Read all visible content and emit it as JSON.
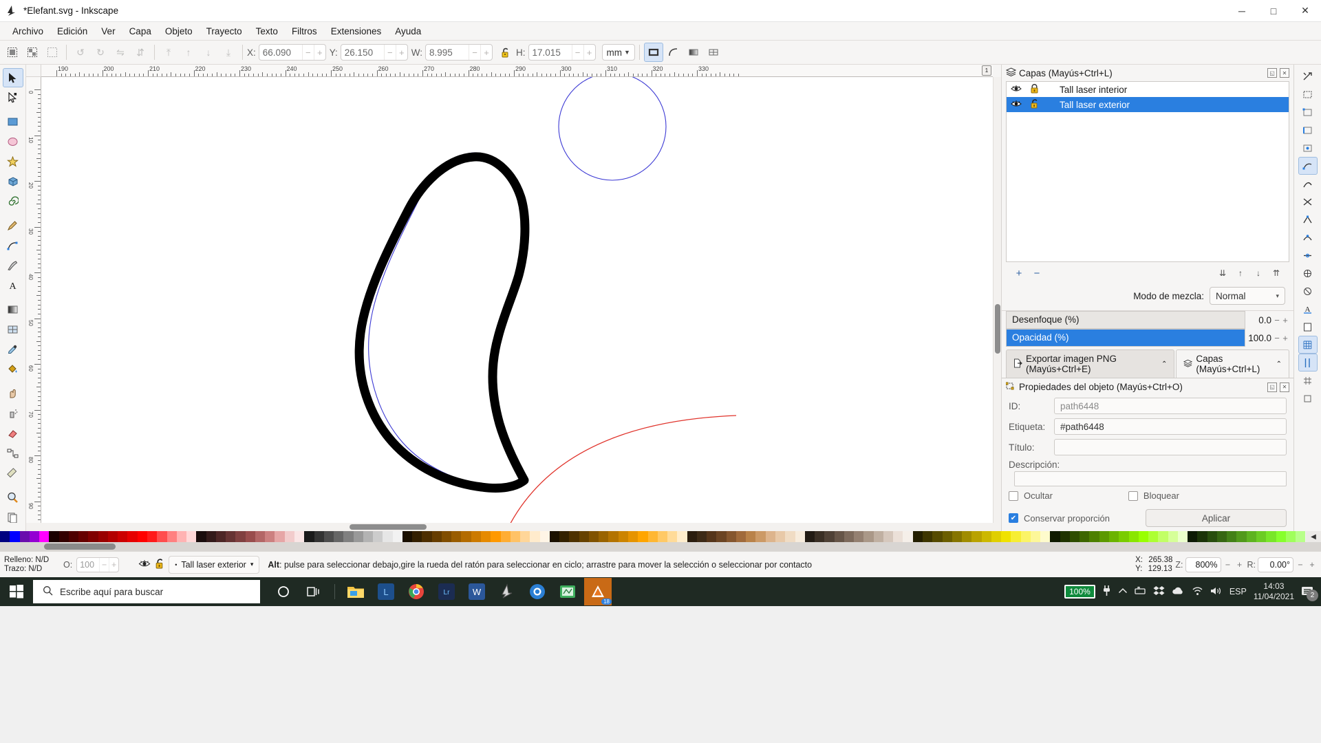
{
  "window": {
    "title": "*Elefant.svg - Inkscape",
    "app_icon": "inkscape-logo-icon",
    "minimize": "─",
    "maximize": "□",
    "close": "✕"
  },
  "menu": {
    "items": [
      "Archivo",
      "Edición",
      "Ver",
      "Capa",
      "Objeto",
      "Trayecto",
      "Texto",
      "Filtros",
      "Extensiones",
      "Ayuda"
    ]
  },
  "toolbar": {
    "select_all_label": "select-all",
    "fields": [
      {
        "label": "X:",
        "value": "66.090"
      },
      {
        "label": "Y:",
        "value": "26.150"
      },
      {
        "label": "W:",
        "value": "8.995"
      },
      {
        "label": "H:",
        "value": "17.015"
      }
    ],
    "lock_icon": "lock-open-icon",
    "units": "mm",
    "minus": "−",
    "plus": "+"
  },
  "toolbox": {
    "tools": [
      {
        "name": "selector-tool",
        "glyph": "➤",
        "selected": true
      },
      {
        "name": "node-tool",
        "glyph": "⤴",
        "selected": false
      },
      {
        "name": "rectangle-tool",
        "glyph": "▭",
        "selected": false
      },
      {
        "name": "ellipse-tool",
        "glyph": "◯",
        "selected": false
      },
      {
        "name": "star-tool",
        "glyph": "★",
        "selected": false
      },
      {
        "name": "3dbox-tool",
        "glyph": "⬟",
        "selected": false
      },
      {
        "name": "spiral-tool",
        "glyph": "◌",
        "selected": false
      },
      {
        "name": "pencil-tool",
        "glyph": "✎",
        "selected": false
      },
      {
        "name": "bezier-tool",
        "glyph": "✒",
        "selected": false
      },
      {
        "name": "calligraphy-tool",
        "glyph": "✑",
        "selected": false
      },
      {
        "name": "text-tool",
        "glyph": "A",
        "selected": false
      },
      {
        "name": "gradient-tool",
        "glyph": "◧",
        "selected": false
      },
      {
        "name": "mesh-tool",
        "glyph": "▦",
        "selected": false
      },
      {
        "name": "dropper-tool",
        "glyph": "⚗",
        "selected": false
      },
      {
        "name": "paintbucket-tool",
        "glyph": "◕",
        "selected": false
      },
      {
        "name": "tweak-tool",
        "glyph": "☝",
        "selected": false
      },
      {
        "name": "spray-tool",
        "glyph": "❁",
        "selected": false
      },
      {
        "name": "eraser-tool",
        "glyph": "▮",
        "selected": false
      },
      {
        "name": "connector-tool",
        "glyph": "⧉",
        "selected": false
      },
      {
        "name": "measure-tool",
        "glyph": "⌖",
        "selected": false
      },
      {
        "name": "zoom-tool",
        "glyph": "⚲",
        "selected": false
      },
      {
        "name": "pages-tool",
        "glyph": "❐",
        "selected": false
      }
    ]
  },
  "canvas": {
    "hruler_labels": [
      "190",
      "200",
      "210",
      "220",
      "230",
      "240",
      "250",
      "260",
      "270",
      "280",
      "290",
      "300",
      "310",
      "320",
      "330"
    ],
    "vruler_labels": [
      "0",
      "10",
      "20",
      "30",
      "40",
      "50",
      "60",
      "70",
      "80",
      "90"
    ],
    "anchor_badge": "1"
  },
  "layers_panel": {
    "title": "Capas (Mayús+Ctrl+L)",
    "dock_icon": "layers-icon",
    "float_icon": "◱",
    "close_icon": "✕",
    "rows": [
      {
        "name": "Tall laser  interior",
        "visible_icon": "eye-icon",
        "lock_icon": "lock-closed-icon",
        "selected": false
      },
      {
        "name": "Tall laser exterior",
        "visible_icon": "eye-icon",
        "lock_icon": "lock-open-icon",
        "selected": true
      }
    ],
    "buttons": {
      "add": "+",
      "remove": "−",
      "raise_top": "⇊",
      "raise": "↑",
      "lower": "↓",
      "lower_bottom": "⇈"
    },
    "blend_label": "Modo de mezcla:",
    "blend_value": "Normal",
    "blend_caret": "▾",
    "sliders": [
      {
        "label": "Desenfoque (%)",
        "value": "0.0",
        "fill_pct": 0,
        "active": false
      },
      {
        "label": "Opacidad (%)",
        "value": "100.0",
        "fill_pct": 100,
        "active": true
      }
    ],
    "slider_minus": "−",
    "slider_plus": "+"
  },
  "dock_tabs": [
    {
      "label": "Exportar imagen PNG (Mayús+Ctrl+E)",
      "icon": "export-png-icon",
      "caret": "⌃",
      "active": false
    },
    {
      "label": "Capas (Mayús+Ctrl+L)",
      "icon": "layers-icon",
      "caret": "⌃",
      "active": true
    }
  ],
  "object_props": {
    "title": "Propiedades del objeto (Mayús+Ctrl+O)",
    "icon": "object-properties-icon",
    "float_icon": "◱",
    "close_icon": "✕",
    "id_label": "ID:",
    "id_value": "path6448",
    "label_label": "Etiqueta:",
    "label_value": "#path6448",
    "title_label": "Título:",
    "title_value": "",
    "desc_label": "Descripción:",
    "desc_value": "",
    "hide_label": "Ocultar",
    "hide_checked": false,
    "lock_label": "Bloquear",
    "lock_checked": false,
    "keep_ratio_label": "Conservar proporción",
    "keep_ratio_checked": true,
    "apply_label": "Aplicar"
  },
  "snapbar": {
    "items": [
      {
        "name": "snap-enable-toggle",
        "glyph": "⧉",
        "on": false
      },
      {
        "name": "snap-bbox-icon",
        "glyph": "▣",
        "on": false
      },
      {
        "name": "snap-bbox-corner-icon",
        "glyph": "◰",
        "on": false
      },
      {
        "name": "snap-bbox-edge-icon",
        "glyph": "◫",
        "on": false
      },
      {
        "name": "snap-bbox-midpoint-icon",
        "glyph": "▩",
        "on": false
      },
      {
        "name": "snap-node-icon",
        "glyph": "⬡",
        "on": true
      },
      {
        "name": "snap-path-icon",
        "glyph": "⦿",
        "on": false
      },
      {
        "name": "snap-path-intersection-icon",
        "glyph": "✕",
        "on": false
      },
      {
        "name": "snap-cusp-node-icon",
        "glyph": "◆",
        "on": false
      },
      {
        "name": "snap-smooth-node-icon",
        "glyph": "●",
        "on": false
      },
      {
        "name": "snap-midpoint-icon",
        "glyph": "⦻",
        "on": false
      },
      {
        "name": "snap-object-center-icon",
        "glyph": "⊕",
        "on": false
      },
      {
        "name": "snap-rotation-center-icon",
        "glyph": "⊗",
        "on": false
      },
      {
        "name": "snap-text-baseline-icon",
        "glyph": "A",
        "on": false
      },
      {
        "name": "snap-page-border-icon",
        "glyph": "▭",
        "on": false
      },
      {
        "name": "snap-grid-icon",
        "glyph": "▦",
        "on": true
      },
      {
        "name": "snap-guide-icon",
        "glyph": "‖",
        "on": true
      },
      {
        "name": "snap-grid-guide-icon",
        "glyph": "⌘",
        "on": false
      },
      {
        "name": "snap-bbox-extra-icon",
        "glyph": "▢",
        "on": false
      }
    ]
  },
  "palette": {
    "colors": [
      "#000080",
      "#0000ff",
      "#6a0dad",
      "#9400d3",
      "#ff00ff",
      "#1a0000",
      "#330000",
      "#4d0000",
      "#660000",
      "#800000",
      "#990000",
      "#b30000",
      "#cc0000",
      "#e60000",
      "#ff0000",
      "#ff1a1a",
      "#ff4d4d",
      "#ff8080",
      "#ffb3b3",
      "#ffd9d9",
      "#1a0d0d",
      "#331a1a",
      "#4d2626",
      "#663333",
      "#804040",
      "#994d4d",
      "#b36666",
      "#cc8080",
      "#e6a6a6",
      "#f2cccc",
      "#fae6e6",
      "#1a1a1a",
      "#333333",
      "#4d4d4d",
      "#666666",
      "#808080",
      "#999999",
      "#b3b3b3",
      "#cccccc",
      "#e6e6e6",
      "#f2f2f2",
      "#1a0f00",
      "#331f00",
      "#4d2e00",
      "#663d00",
      "#804d00",
      "#995c00",
      "#b36b00",
      "#cc7a00",
      "#e68a00",
      "#ff9900",
      "#ffad33",
      "#ffc266",
      "#ffd699",
      "#ffebcc",
      "#fff5e6",
      "#1a1000",
      "#332100",
      "#4d3100",
      "#664200",
      "#805200",
      "#996300",
      "#b37300",
      "#cc8400",
      "#e69400",
      "#ffa500",
      "#ffb733",
      "#ffc966",
      "#ffdb99",
      "#ffedcc",
      "#2b1d0e",
      "#3d2a16",
      "#55351a",
      "#6b4423",
      "#85562e",
      "#a06a3b",
      "#b98249",
      "#cc9a66",
      "#ddb48c",
      "#e8c9a8",
      "#f0dcc4",
      "#f7ecdd",
      "#221b14",
      "#3a2f25",
      "#4f4136",
      "#665548",
      "#7d6a5c",
      "#948071",
      "#aa9888",
      "#c0b0a2",
      "#d6c8bd",
      "#ebe0d8",
      "#f5efe9",
      "#241f00",
      "#3d3500",
      "#554a00",
      "#6b5e00",
      "#857400",
      "#a08c00",
      "#b9a200",
      "#ccb800",
      "#e0cf00",
      "#f0e200",
      "#f7ee33",
      "#fbf466",
      "#fdf799",
      "#fefbcc",
      "#0f1a00",
      "#1f3300",
      "#2e4d00",
      "#3d6600",
      "#4d8000",
      "#5c9900",
      "#6bb300",
      "#7acc00",
      "#8ae600",
      "#99ff00",
      "#adff33",
      "#c2ff66",
      "#d6ff99",
      "#ebffcc",
      "#0d1a05",
      "#1b3309",
      "#284d0e",
      "#366612",
      "#438017",
      "#51991b",
      "#5eb320",
      "#6ccc24",
      "#79e629",
      "#87ff2d",
      "#a0ff5c",
      "#b8ff8a"
    ],
    "scroll_arrow": "◀"
  },
  "statusbar": {
    "fill_label": "Relleno:",
    "fill_value": "N/D",
    "stroke_label": "Trazo:",
    "stroke_value": "N/D",
    "opacity_label": "O:",
    "opacity_value": "100",
    "eye_icon": "eye-icon",
    "lock_icon": "lock-open-icon",
    "layer_name": "Tall laser exterior",
    "layer_caret": "▾",
    "hint_bold": "Alt",
    "hint_text": ": pulse para seleccionar debajo,gire la rueda del ratón para seleccionar en ciclo; arrastre para mover la selección o seleccionar por contacto",
    "coord_x_label": "X:",
    "coord_x": "265.38",
    "coord_y_label": "Y:",
    "coord_y": "129.13",
    "zoom_label": "Z:",
    "zoom_value": "800%",
    "rotate_label": "R:",
    "rotate_value": "0.00°",
    "minus": "−",
    "plus": "+"
  },
  "taskbar": {
    "start_icon": "windows-start-icon",
    "search_icon": "search-icon",
    "search_placeholder": "Escribe aquí para buscar",
    "cortana_icon": "cortana-icon",
    "taskview_icon": "task-view-icon",
    "apps": [
      {
        "name": "file-explorer-icon",
        "glyph": "📁",
        "color": "#ffc64b"
      },
      {
        "name": "lightroom-classic-icon",
        "glyph": "L",
        "color": "#2b7fd4"
      },
      {
        "name": "google-chrome-icon",
        "glyph": "◉",
        "color": "#e8453c"
      },
      {
        "name": "lightroom-icon",
        "glyph": "Lr",
        "color": "#1f3d6b"
      },
      {
        "name": "word-icon",
        "glyph": "W",
        "color": "#2b579a"
      },
      {
        "name": "inkscape-icon",
        "glyph": "⬟",
        "color": "#555555"
      },
      {
        "name": "firefox-icon",
        "glyph": "◉",
        "color": "#2b7fd4"
      },
      {
        "name": "estlcam-icon",
        "glyph": "▣",
        "color": "#3fae5e"
      },
      {
        "name": "lightburn-icon",
        "glyph": "▲",
        "color": "#e87722",
        "badge": "18"
      }
    ],
    "tray": {
      "battery_pct": "100%",
      "power_icon": "power-plug-icon",
      "chevron_icon": "show-hidden-icons-icon",
      "usb_icon": "usb-device-icon",
      "dropbox_icon": "dropbox-icon",
      "onedrive_icon": "onedrive-icon",
      "wifi_icon": "wifi-icon",
      "volume_icon": "volume-icon",
      "language": "ESP",
      "time": "14:03",
      "date": "11/04/2021",
      "notifications_icon": "notifications-icon",
      "notifications_count": "2"
    }
  }
}
